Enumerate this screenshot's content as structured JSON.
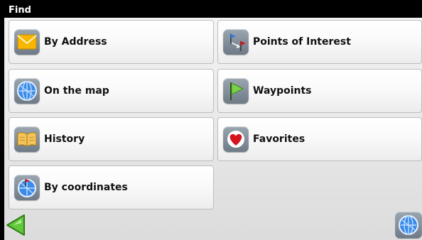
{
  "window": {
    "title": "Find"
  },
  "menu": {
    "items": [
      {
        "label": "By Address",
        "icon": "envelope-icon"
      },
      {
        "label": "Points of Interest",
        "icon": "poi-flags-icon"
      },
      {
        "label": "On the map",
        "icon": "globe-icon"
      },
      {
        "label": "Waypoints",
        "icon": "green-flag-icon"
      },
      {
        "label": "History",
        "icon": "open-book-icon"
      },
      {
        "label": "Favorites",
        "icon": "heart-icon"
      },
      {
        "label": "By coordinates",
        "icon": "globe-pin-icon"
      }
    ]
  },
  "footer": {
    "back_icon": "back-arrow-icon",
    "map_icon": "globe-icon"
  },
  "colors": {
    "title_bg": "#000000",
    "title_text": "#ffffff",
    "panel_bg": "#e8e8e8",
    "back_arrow": "#5cc23a",
    "envelope": "#f5b800",
    "globe": "#2a7de1",
    "heart": "#d4141e"
  }
}
